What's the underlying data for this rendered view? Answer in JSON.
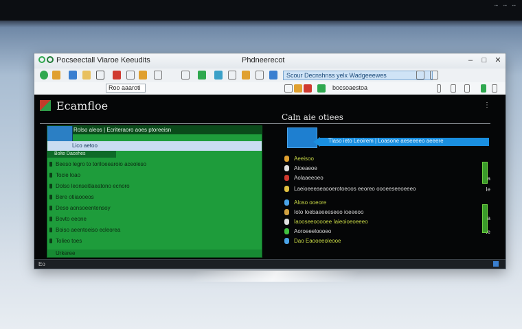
{
  "bezel": {
    "label": "⋯ ⋯ ⋯"
  },
  "window": {
    "app_title": "Pocseectall Viaroe Keeudits",
    "document_title": "Phdneerecot",
    "controls": [
      "–",
      "□",
      "✕"
    ]
  },
  "toolbar": {
    "search_text": "Scour Decnshnss yelx Wadgeeewes",
    "icons": [
      "back-icon",
      "forward-icon",
      "folder-icon",
      "save-icon",
      "print-icon",
      "edit-icon",
      "copy-icon",
      "paste-icon",
      "tag-icon",
      "settings-icon"
    ]
  },
  "address": {
    "left_field": "Roo aaaroti",
    "right_field": "bocsoaestoa"
  },
  "content": {
    "page_title": "Ecamfloe",
    "right_heading": "Caln aie otiees",
    "green_panel": {
      "header": "Rolso aleos | Ecriteraoro aoes ptoreeisn",
      "selected_row": "Lico aetoo",
      "sub_header": "Bolte Dacehes",
      "rows": [
        "Beeso legro to toriloeearoio aceoleso",
        "Tocie loao",
        "Dolso leonseitlaeatono ecnoro",
        "Bere otiiaooeos",
        "Deso aonsoeentensoy",
        "Bovto eeone",
        "Boiso aeentoeiso ecleorea",
        "Tolieo toes"
      ],
      "footer": "Urkeree"
    },
    "blue_bar_text": "Tlaso ieto Leoirem | Loasone aeseeeeo aeeere",
    "right_list": [
      {
        "text": "Aeeisoo",
        "accent": true,
        "color": "#e0a030"
      },
      {
        "text": "Aioeaeoe",
        "accent": false,
        "color": "#e0e0e0"
      },
      {
        "text": "Aolaaeeoeo",
        "accent": false,
        "color": "#d03a30"
      },
      {
        "text": "Laeioeeeaeaooerotoeoos eeoreo oooeeseeoeeeo",
        "accent": false,
        "color": "#e0c040"
      },
      {
        "text": "Aloso ooeore",
        "accent": true,
        "color": "#4aa3e8"
      },
      {
        "text": "Ioto Ioebaeeeeseeo ioeeeoo",
        "accent": false,
        "color": "#d0a040"
      },
      {
        "text": "Iaooseeooooee Iaieoioeoeeeo",
        "accent": true,
        "color": "#e0e0e0"
      },
      {
        "text": "Aoroeeeloooeo",
        "accent": false,
        "color": "#40c040"
      },
      {
        "text": "Dao Eaooeeoleooe",
        "accent": true,
        "color": "#4aa3e8"
      }
    ],
    "side_marks": [
      "Ja",
      "Ie",
      "Ia",
      "Ie"
    ]
  },
  "status": {
    "left": "Eo"
  }
}
